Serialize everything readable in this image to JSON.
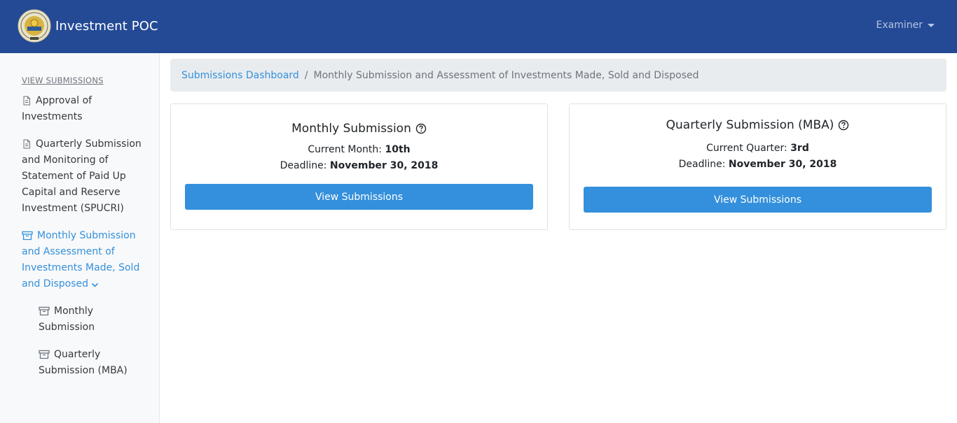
{
  "header": {
    "brand_title": "Investment POC",
    "logo_icon": "commission-seal-icon",
    "user_menu_label": "Examiner"
  },
  "sidebar": {
    "heading": "VIEW SUBMISSIONS",
    "items": [
      {
        "lines": [
          "Approval of",
          "Investments"
        ],
        "icon": "document-icon"
      },
      {
        "lines": [
          "Quarterly Submission",
          "and Monitoring of",
          "Statement of Paid Up",
          "Capital and Reserve",
          "Investment (SPUCRI)"
        ],
        "icon": "document-icon"
      },
      {
        "lines": [
          "Monthly Submission",
          "and Assessment of",
          "Investments Made, Sold",
          "and Disposed"
        ],
        "icon": "archive-icon",
        "active": true,
        "expanded": true
      },
      {
        "lines": [
          "Monthly",
          "Submission"
        ],
        "icon": "archive-icon",
        "sub": true
      },
      {
        "lines": [
          "Quarterly",
          "Submission (MBA)"
        ],
        "icon": "archive-icon",
        "sub": true
      }
    ]
  },
  "breadcrumb": {
    "link": "Submissions Dashboard",
    "separator": "/",
    "current": "Monthly Submission and Assessment of Investments Made, Sold and Disposed"
  },
  "cards": [
    {
      "title": "Monthly Submission",
      "period_label": "Current Month:",
      "period_value": "10th",
      "deadline_label": "Deadline:",
      "deadline_value": "November 30, 2018",
      "button_label": "View Submissions"
    },
    {
      "title": "Quarterly Submission (MBA)",
      "period_label": "Current Quarter:",
      "period_value": "3rd",
      "deadline_label": "Deadline:",
      "deadline_value": "November 30, 2018",
      "button_label": "View Submissions"
    }
  ],
  "colors": {
    "navbar": "#244a96",
    "accent": "#3490dc",
    "sidebar_bg": "#f8f9fa",
    "breadcrumb_bg": "#e9ecef"
  }
}
